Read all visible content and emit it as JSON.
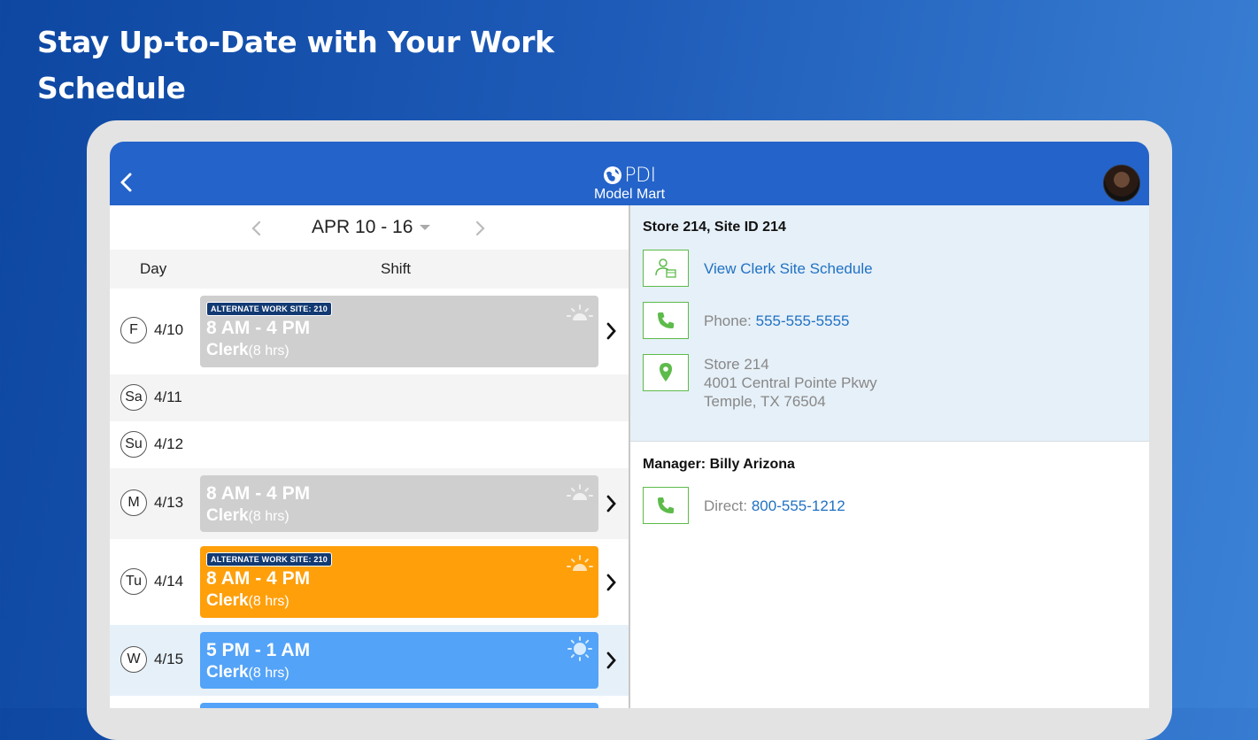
{
  "headline": {
    "line1": "Stay Up-to-Date with Your Work",
    "line2": "Schedule"
  },
  "app": {
    "brand": "PDI",
    "subtitle": "Model Mart"
  },
  "week": {
    "label": "APR 10 - 16"
  },
  "columns": {
    "day": "Day",
    "shift": "Shift"
  },
  "days": [
    {
      "abbr": "F",
      "date": "4/10",
      "badge": "ALTERNATE WORK SITE: 210",
      "time": "8 AM - 4 PM",
      "role": "Clerk",
      "hours": "(8 hrs)",
      "status": "past",
      "icon": "sunrise-icon"
    },
    {
      "abbr": "Sa",
      "date": "4/11"
    },
    {
      "abbr": "Su",
      "date": "4/12"
    },
    {
      "abbr": "M",
      "date": "4/13",
      "time": "8 AM - 4 PM",
      "role": "Clerk",
      "hours": "(8 hrs)",
      "status": "past",
      "icon": "sunrise-icon"
    },
    {
      "abbr": "Tu",
      "date": "4/14",
      "badge": "ALTERNATE WORK SITE: 210",
      "time": "8 AM - 4 PM",
      "role": "Clerk",
      "hours": "(8 hrs)",
      "status": "current",
      "icon": "sunrise-icon"
    },
    {
      "abbr": "W",
      "date": "4/15",
      "time": "5 PM - 1 AM",
      "role": "Clerk",
      "hours": "(8 hrs)",
      "status": "upcoming",
      "icon": "sun-icon"
    }
  ],
  "colors": {
    "past": "#cfcfcf",
    "current": "#ff9f0a",
    "upcoming": "#53a3f8",
    "accent": "#2463c9",
    "icon_green": "#5dbb4a",
    "link": "#1f71c4"
  },
  "store": {
    "title": "Store 214, Site ID 214",
    "schedule_link": "View Clerk Site Schedule",
    "phone_label": "Phone: ",
    "phone": "555-555-5555",
    "address_line1": "Store 214",
    "address_line2": "4001 Central Pointe Pkwy",
    "address_line3": "Temple, TX 76504"
  },
  "manager": {
    "title": "Manager: Billy Arizona",
    "direct_label": "Direct: ",
    "direct": "800-555-1212"
  }
}
